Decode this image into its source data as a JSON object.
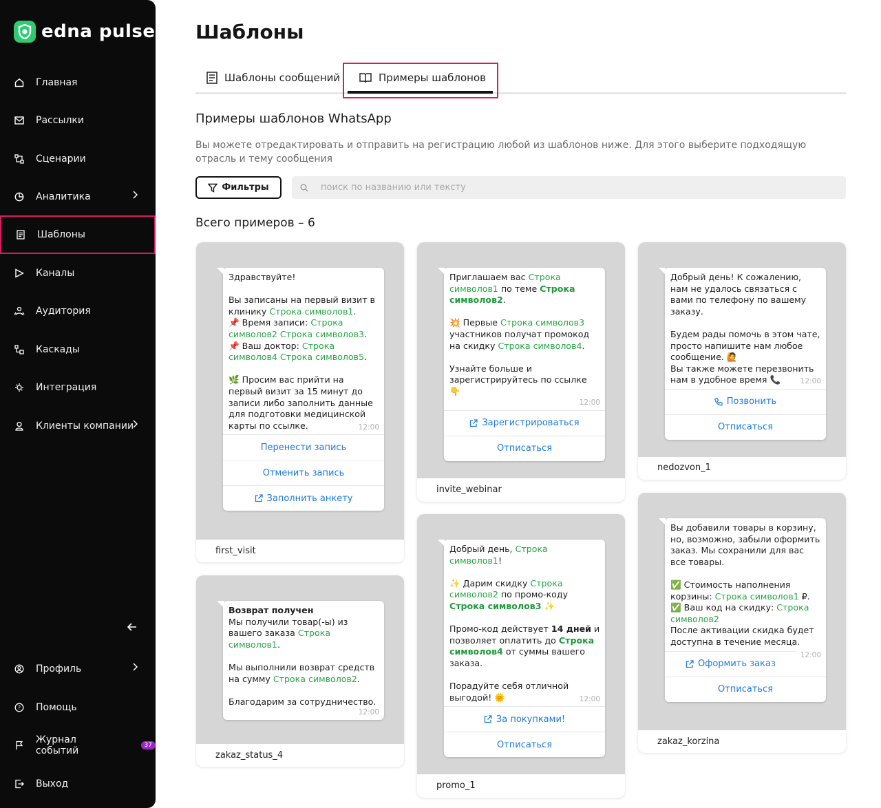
{
  "brand": {
    "name": "edna pulse",
    "color": "#2ecc71"
  },
  "sidebar": {
    "items": [
      {
        "label": "Главная",
        "icon": "home-icon"
      },
      {
        "label": "Рассылки",
        "icon": "mail-icon"
      },
      {
        "label": "Сценарии",
        "icon": "scenario-icon"
      },
      {
        "label": "Аналитика",
        "icon": "analytics-icon",
        "has_submenu": true
      },
      {
        "label": "Шаблоны",
        "icon": "templates-icon",
        "active": true
      },
      {
        "label": "Каналы",
        "icon": "channels-icon"
      },
      {
        "label": "Аудитория",
        "icon": "audience-icon"
      },
      {
        "label": "Каскады",
        "icon": "cascades-icon"
      },
      {
        "label": "Интеграция",
        "icon": "integration-icon"
      },
      {
        "label": "Клиенты компании",
        "icon": "clients-icon",
        "has_submenu": true
      }
    ],
    "bottom": [
      {
        "label": "Профиль",
        "icon": "profile-icon",
        "has_submenu": true
      },
      {
        "label": "Помощь",
        "icon": "help-icon"
      },
      {
        "label": "Журнал событий",
        "icon": "flag-icon",
        "badge": "37"
      },
      {
        "label": "Выход",
        "icon": "logout-icon"
      }
    ],
    "active_outline_color": "#d81b60"
  },
  "page": {
    "title": "Шаблоны",
    "tabs": [
      {
        "label": "Шаблоны сообщений",
        "icon": "list-icon"
      },
      {
        "label": "Примеры шаблонов",
        "icon": "book-icon",
        "active": true
      }
    ],
    "section_title": "Примеры шаблонов WhatsApp",
    "section_desc": "Вы можете отредактировать и отправить на регистрацию любой из шаблонов ниже. Для этого выберите подходящую отрасль и тему сообщения",
    "filter_label": "Фильтры",
    "search_placeholder": "поиск по названию или тексту",
    "total_label": "Всего примеров – 6"
  },
  "cards": [
    {
      "name": "first_visit",
      "time": "12:00",
      "text": {
        "greeting": "Здравствуйте!",
        "p1": "Вы записаны на первый визит в клинику",
        "v1": "Строка символов1",
        "l2": "📌 Время записи:",
        "v2": "Строка символов2 Строка символов3",
        "l3": "📌 Ваш доктор:",
        "v3": "Строка символов4 Строка символов5",
        "p2": "🌿 Просим вас прийти на первый визит за 15 минут до записи либо заполнить данные для подготовки медицинской карты по ссылке."
      },
      "buttons": [
        "Перенести запись",
        "Отменить запись",
        "Заполнить анкету"
      ]
    },
    {
      "name": "invite_webinar",
      "time": "12:00",
      "text": {
        "l1": "Приглашаем вас",
        "v1": "Строка символов1",
        "l1b": "по теме",
        "v2": "Строка символов2",
        "l2": "💥 Первые",
        "v3": "Строка символов3",
        "l2b": "участников получат промокод на скидку",
        "v4": "Строка символов4",
        "l3": "Узнайте больше и зарегистрируйтесь по ссылке 👇"
      },
      "buttons": [
        "Зарегистрироваться",
        "Отписаться"
      ]
    },
    {
      "name": "nedozvon_1",
      "time": "12:00",
      "text": {
        "p1": "Добрый день! К сожалению, нам не удалось связаться с вами по телефону по вашему заказу.",
        "p2": "Будем рады помочь в этом чате, просто напишите нам любое сообщение. 🙋",
        "p3": "Вы также можете перезвонить нам в удобное время 📞"
      },
      "buttons": [
        "Позвонить",
        "Отписаться"
      ]
    },
    {
      "name": "zakaz_status_4",
      "time": "12:00",
      "text": {
        "header": "Возврат получен",
        "l1": "Мы получили товар(-ы) из вашего заказа",
        "v1": "Строка символов1",
        "l2": "Мы выполнили возврат средств на сумму",
        "v2": "Строка символов2",
        "l3": "Благодарим за сотрудничество."
      },
      "buttons": []
    },
    {
      "name": "promo_1",
      "time": "12:00",
      "text": {
        "l1": "Добрый день,",
        "v1": "Строка символов1",
        "l2": "✨ Дарим скидку",
        "v2": "Строка символов2",
        "l2b": "по промо-коду",
        "v3": "Строка символов3",
        "l3": "Промо-код действует",
        "b1": "14 дней",
        "l3b": "и позволяет оплатить до",
        "v4": "Строка символов4",
        "l3c": "от суммы вашего заказа.",
        "l4": "Порадуйте себя отличной выгодой! 🌞"
      },
      "buttons": [
        "За покупками!",
        "Отписаться"
      ]
    },
    {
      "name": "zakaz_korzina",
      "time": "12:00",
      "text": {
        "p1": "Вы добавили товары в корзину, но, возможно, забыли оформить заказ. Мы сохранили для вас все товары.",
        "l2": "✅ Стоимость наполнения корзины:",
        "v1": "Строка символов1",
        "l2b": "₽.",
        "l3": "✅ Ваш код на скидку:",
        "v2": "Строка символов2",
        "l4": "После активации скидка будет доступна в течение месяца."
      },
      "buttons": [
        "Оформить заказ",
        "Отписаться"
      ]
    }
  ]
}
